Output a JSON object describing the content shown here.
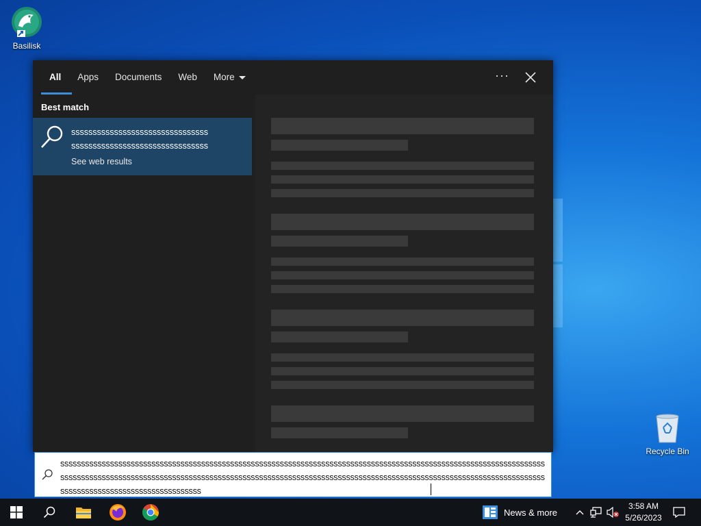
{
  "desktop": {
    "icons": [
      {
        "label": "Basilisk"
      },
      {
        "label": "Recycle Bin"
      }
    ]
  },
  "search_panel": {
    "tabs": [
      {
        "label": "All",
        "active": true
      },
      {
        "label": "Apps"
      },
      {
        "label": "Documents"
      },
      {
        "label": "Web"
      },
      {
        "label": "More"
      }
    ],
    "options_icon": "more-options-icon",
    "close_icon": "close-icon",
    "best_match_label": "Best match",
    "result": {
      "line1": "ssssssssssssssssssssssssssssssss",
      "line2": "ssssssssssssssssssssssssssssssss",
      "subtext": "See web results"
    }
  },
  "search_box": {
    "value": "ssssssssssssssssssssssssssssssssssssssssssssssssssssssssssssssssssssssssssssssssssssssssssssssssssssssssssssssssssssssssssssssssssssssssssssssssssssssssssssssssssssssssssssssssssssssssssssssssssssssssssssssssssssssssssssssssssssssssssssssssssssssssssssssssssssssssssss"
  },
  "taskbar": {
    "news_label": "News & more",
    "time": "3:58 AM",
    "date": "5/26/2023"
  },
  "colors": {
    "accent": "#3b8fd8",
    "result_bg": "#1f4566",
    "panel_bg": "#1f1f1f",
    "taskbar_bg": "#101418"
  }
}
